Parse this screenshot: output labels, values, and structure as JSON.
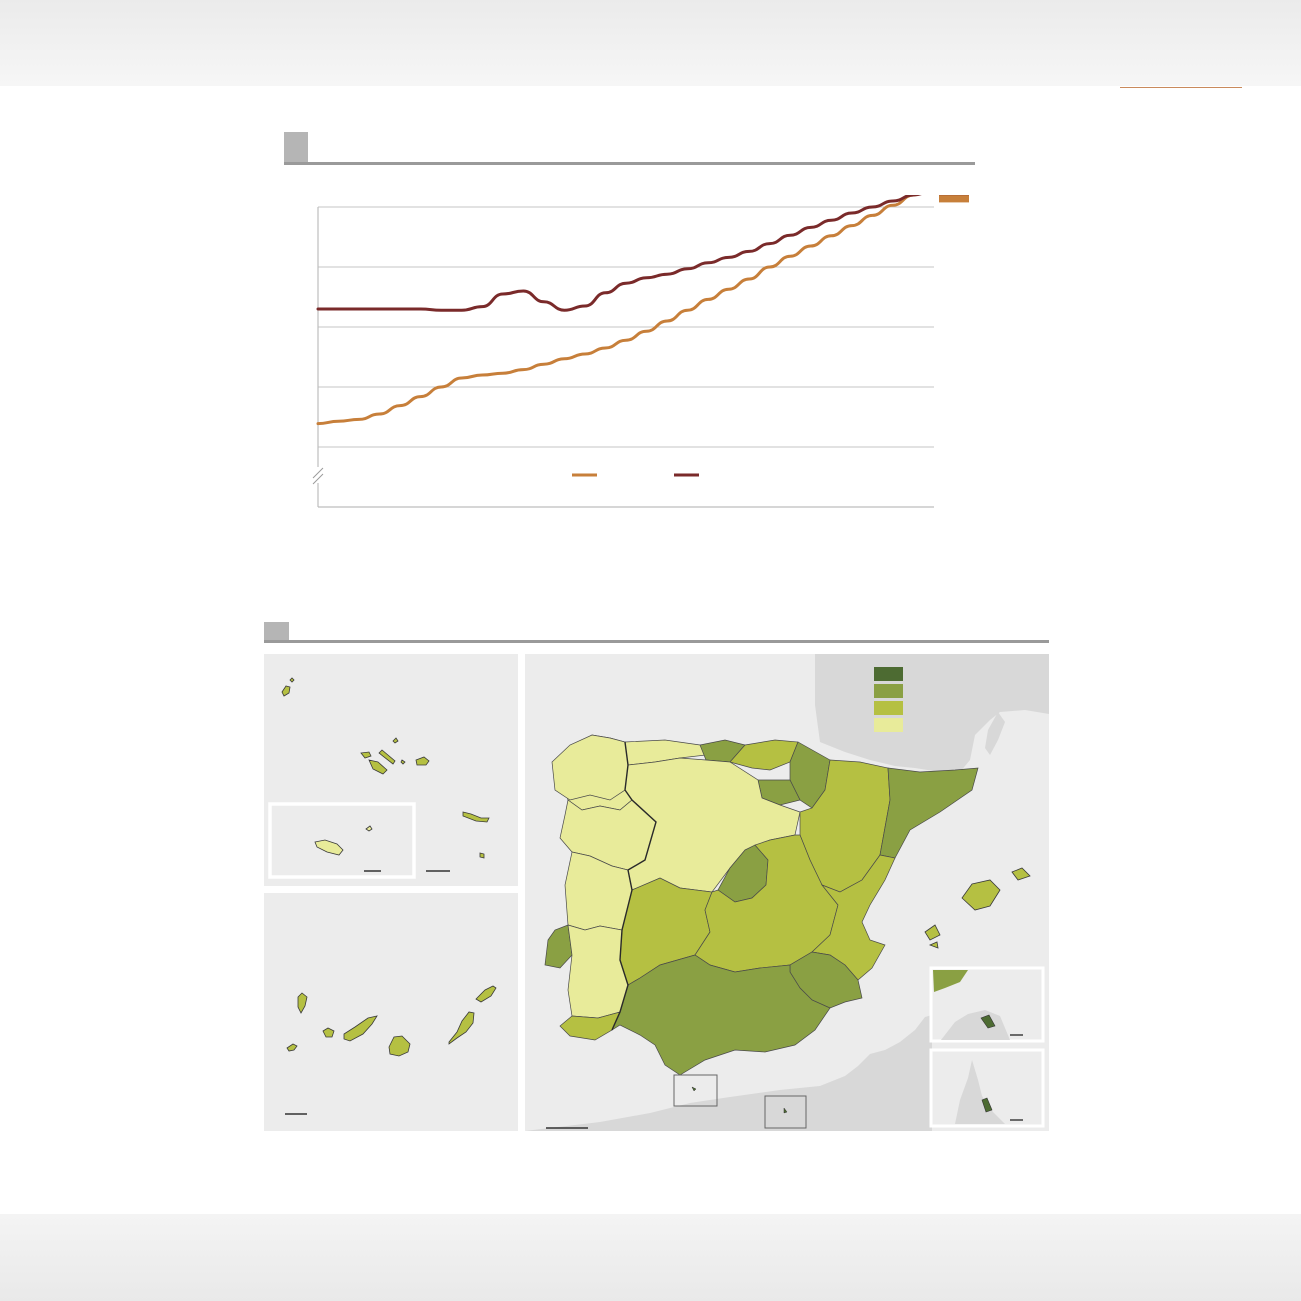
{
  "colors": {
    "page_bg": "#ffffff",
    "header_bg": "#eeeeee",
    "section_marker": "#b5b5b5",
    "section_rule": "#9a9a9a",
    "header_accent": "#c98a5c"
  },
  "chart_data": {
    "type": "line",
    "axis_break": true,
    "grid": "horizontal",
    "y_gridlines": 5,
    "x": [
      0,
      1,
      2,
      3,
      4,
      5,
      6,
      7,
      8,
      9,
      10,
      11,
      12,
      13,
      14,
      15,
      16,
      17,
      18,
      19,
      20,
      21,
      22,
      23,
      24,
      25,
      26,
      27,
      28,
      29,
      30
    ],
    "xlim": [
      0,
      30
    ],
    "ylim": [
      0,
      5
    ],
    "series": [
      {
        "color": "#c77f3a",
        "values": [
          1.39,
          1.43,
          1.46,
          1.55,
          1.69,
          1.84,
          2.0,
          2.15,
          2.2,
          2.23,
          2.29,
          2.38,
          2.47,
          2.55,
          2.65,
          2.78,
          2.93,
          3.1,
          3.28,
          3.46,
          3.63,
          3.8,
          4.0,
          4.18,
          4.35,
          4.52,
          4.69,
          4.86,
          5.03,
          5.2,
          5.36
        ]
      },
      {
        "color": "#7a2a2a",
        "values": [
          3.3,
          3.3,
          3.3,
          3.3,
          3.3,
          3.3,
          3.28,
          3.28,
          3.34,
          3.55,
          3.6,
          3.42,
          3.28,
          3.35,
          3.57,
          3.73,
          3.82,
          3.88,
          3.97,
          4.07,
          4.16,
          4.26,
          4.39,
          4.53,
          4.66,
          4.78,
          4.9,
          5.0,
          5.1,
          5.2,
          5.28
        ]
      }
    ]
  },
  "map": {
    "scale": "choropleth",
    "legend_colors": [
      "#4d6b32",
      "#8aa043",
      "#b5c042",
      "#e8eb9a"
    ],
    "colors": {
      "sea": "#ececec",
      "land_outside": "#d8d8d8",
      "border": "#3a3a3a",
      "inset_frame": "#ffffff",
      "box": "#666666"
    }
  }
}
